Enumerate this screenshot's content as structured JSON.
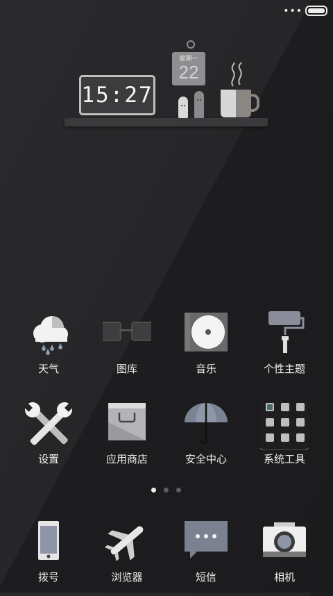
{
  "status": {
    "menu_icon": "more-dots-icon",
    "battery_icon": "battery-icon"
  },
  "widget": {
    "time": "15:27",
    "weekday": "星期一",
    "day": "22"
  },
  "apps_row1": [
    {
      "label": "天气",
      "icon": "weather-icon"
    },
    {
      "label": "图库",
      "icon": "gallery-icon"
    },
    {
      "label": "音乐",
      "icon": "music-icon"
    },
    {
      "label": "个性主题",
      "icon": "themes-icon"
    }
  ],
  "apps_row2": [
    {
      "label": "设置",
      "icon": "settings-icon"
    },
    {
      "label": "应用商店",
      "icon": "app-store-icon"
    },
    {
      "label": "安全中心",
      "icon": "security-icon"
    },
    {
      "label": "系统工具",
      "icon": "system-tools-folder-icon"
    }
  ],
  "pager": {
    "pages": 3,
    "current": 1
  },
  "dock": [
    {
      "label": "拨号",
      "icon": "phone-icon"
    },
    {
      "label": "浏览器",
      "icon": "browser-icon"
    },
    {
      "label": "短信",
      "icon": "messages-icon"
    },
    {
      "label": "相机",
      "icon": "camera-icon"
    }
  ]
}
